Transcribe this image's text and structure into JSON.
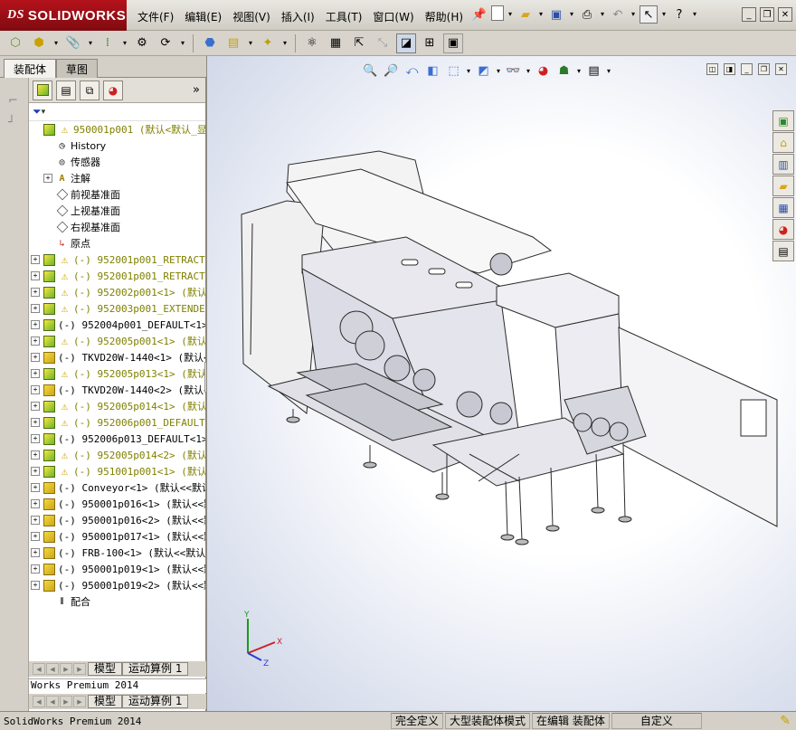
{
  "app": {
    "brand_prefix": "DS",
    "brand": "SOLIDWORKS",
    "menu": [
      "文件(F)",
      "编辑(E)",
      "视图(V)",
      "插入(I)",
      "工具(T)",
      "窗口(W)",
      "帮助(H)"
    ],
    "title_icons": [
      "pin-icon",
      "new-document-icon",
      "open-folder-icon",
      "save-icon",
      "print-icon",
      "undo-icon",
      "select-arrow-icon",
      "help-icon"
    ],
    "window_buttons": [
      "minimize",
      "restore",
      "close"
    ]
  },
  "left_panel": {
    "tabs": [
      "装配体",
      "草图"
    ],
    "expand_more": "»",
    "filter_label": "▾",
    "tree": [
      {
        "label": "950001p001  (默认<默认_显示",
        "state": "warn",
        "expand": false,
        "icon": "assembly",
        "color": "olive"
      },
      {
        "label": "History",
        "icon": "history",
        "expand": false,
        "color": "blk",
        "indent": 1
      },
      {
        "label": "传感器",
        "icon": "sensor",
        "expand": false,
        "color": "blk",
        "indent": 1
      },
      {
        "label": "注解",
        "icon": "annotation",
        "expand": true,
        "color": "blk",
        "indent": 1
      },
      {
        "label": "前视基准面",
        "icon": "plane",
        "expand": false,
        "color": "blk",
        "indent": 1
      },
      {
        "label": "上视基准面",
        "icon": "plane",
        "expand": false,
        "color": "blk",
        "indent": 1
      },
      {
        "label": "右视基准面",
        "icon": "plane",
        "expand": false,
        "color": "blk",
        "indent": 1
      },
      {
        "label": "原点",
        "icon": "origin",
        "expand": false,
        "color": "blk",
        "indent": 1
      },
      {
        "label": "(-) 952001p001_RETRACTE",
        "state": "warn",
        "expand": true,
        "icon": "assembly",
        "color": "olive"
      },
      {
        "label": "(-) 952001p001_RETRACTE",
        "state": "warn",
        "expand": true,
        "icon": "assembly",
        "color": "olive"
      },
      {
        "label": "(-) 952002p001<1> (默认",
        "state": "warn",
        "expand": true,
        "icon": "assembly",
        "color": "olive"
      },
      {
        "label": "(-) 952003p001_EXTENDED",
        "state": "warn",
        "expand": true,
        "icon": "assembly",
        "color": "olive"
      },
      {
        "label": "(-) 952004p001_DEFAULT<1>",
        "state": "none",
        "expand": true,
        "icon": "assembly",
        "color": "blk"
      },
      {
        "label": "(-) 952005p001<1> (默认",
        "state": "warn",
        "expand": true,
        "icon": "assembly",
        "color": "olive"
      },
      {
        "label": "(-) TKVD20W-1440<1> (默认<",
        "state": "none",
        "expand": true,
        "icon": "part",
        "color": "blk"
      },
      {
        "label": "(-) 952005p013<1> (默认",
        "state": "warn",
        "expand": true,
        "icon": "assembly",
        "color": "olive"
      },
      {
        "label": "(-) TKVD20W-1440<2> (默认<",
        "state": "none",
        "expand": true,
        "icon": "part",
        "color": "blk"
      },
      {
        "label": "(-) 952005p014<1> (默认",
        "state": "warn",
        "expand": true,
        "icon": "assembly",
        "color": "olive"
      },
      {
        "label": "(-) 952006p001_DEFAULT<",
        "state": "warn",
        "expand": true,
        "icon": "assembly",
        "color": "olive"
      },
      {
        "label": "(-) 952006p013_DEFAULT<1>",
        "state": "none",
        "expand": true,
        "icon": "assembly",
        "color": "blk"
      },
      {
        "label": "(-) 952005p014<2> (默认",
        "state": "warn",
        "expand": true,
        "icon": "assembly",
        "color": "olive"
      },
      {
        "label": "(-) 951001p001<1> (默认",
        "state": "warn",
        "expand": true,
        "icon": "assembly",
        "color": "olive"
      },
      {
        "label": "(-) Conveyor<1> (默认<<默认",
        "state": "none",
        "expand": true,
        "icon": "part",
        "color": "blk"
      },
      {
        "label": "(-) 950001p016<1> (默认<<默",
        "state": "none",
        "expand": true,
        "icon": "part",
        "color": "blk"
      },
      {
        "label": "(-) 950001p016<2> (默认<<默",
        "state": "none",
        "expand": true,
        "icon": "part",
        "color": "blk"
      },
      {
        "label": "(-) 950001p017<1> (默认<<默",
        "state": "none",
        "expand": true,
        "icon": "part",
        "color": "blk"
      },
      {
        "label": "(-) FRB-100<1> (默认<<默认",
        "state": "none",
        "expand": true,
        "icon": "part",
        "color": "blk"
      },
      {
        "label": "(-) 950001p019<1> (默认<<默",
        "state": "none",
        "expand": true,
        "icon": "part",
        "color": "blk"
      },
      {
        "label": "(-) 950001p019<2> (默认<<默",
        "state": "none",
        "expand": true,
        "icon": "part",
        "color": "blk"
      },
      {
        "label": "配合",
        "icon": "mates",
        "expand": false,
        "color": "blk",
        "indent": 1
      }
    ],
    "bottom_tabs_1": [
      "模型",
      "运动算例 1"
    ],
    "ghost_status": "Works Premium 2014",
    "bottom_tabs_2": [
      "模型",
      "运动算例 1"
    ]
  },
  "viewport": {
    "view_icons": [
      "zoom-to-fit-icon",
      "zoom-area-icon",
      "previous-view-icon",
      "section-view-icon",
      "view-orientation-icon",
      "display-style-icon",
      "hide-show-icon",
      "appearance-icon",
      "scene-icon",
      "view-settings-icon"
    ],
    "right_icons": [
      "resources-icon",
      "home-icon",
      "design-library-icon",
      "file-explorer-icon",
      "view-palette-icon",
      "appearances-icon",
      "custom-properties-icon"
    ],
    "triad": {
      "x": "X",
      "y": "Y",
      "z": "Z"
    }
  },
  "statusbar": {
    "product": "SolidWorks Premium 2014",
    "fully_defined": "完全定义",
    "large_assembly": "大型装配体模式",
    "editing": "在编辑 装配体",
    "custom": "自定义"
  },
  "colors": {
    "brand_red": "#b5121b",
    "warn_yellow": "#c8a200",
    "olive_text": "#808000"
  }
}
